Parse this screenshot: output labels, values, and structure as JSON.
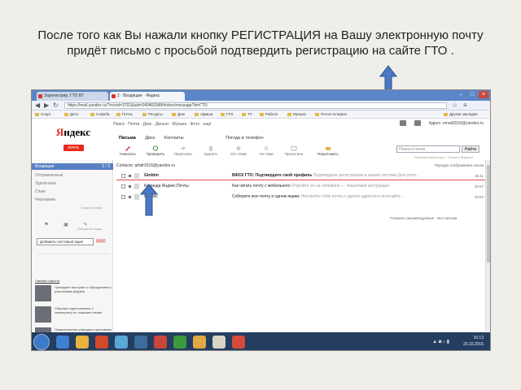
{
  "caption": "После того как Вы нажали кнопку РЕГИСТРАЦИЯ на Вашу электронную почту придёт письмо с просьбой  подтвердить регистрацию на сайте ГТО .",
  "browser": {
    "tabs": [
      "Зарегистрир. ГТО ВТ",
      "2 · Входящие · Яндекс"
    ],
    "url": "https://mail.yandex.ru/?ncrnd=3701&uid=340469348#inbox/message?id=ГТО",
    "bookmarks": [
      "Спорт",
      "Дети",
      "Служба",
      "Почта",
      "Ресурсы",
      "Дом",
      "Афиша",
      "ГТО",
      "TV",
      "Работа",
      "Музыка",
      "Почта телефон"
    ],
    "bookmark_right": "Другие закладки"
  },
  "page": {
    "top_menu": "Поиск · Почта · Диск · Деньги · Музыка · Фото · ещё",
    "user_email": "Адрес: email2016@yandex.ru",
    "logo_text": "Яндекс",
    "logo_badge": "почта",
    "tabs": [
      "Письма",
      "Диск",
      "Контакты",
      "Погода в телефон"
    ],
    "toolbar": [
      "Написать",
      "Проверить",
      "Переслать",
      "Удалить",
      "Это спам!",
      "Не спам",
      "Прочитано",
      "Переложить"
    ],
    "search_placeholder": "Поиск в почте",
    "search_button": "Найти",
    "search_sub": "Расширенный поиск · Поиск в Яндексе",
    "list_header": "Contacts: arbitr2016@yandex.ru",
    "list_header_right": "Порядок отображения писем",
    "emails": [
      {
        "from": "Gtobtm",
        "subject": "ВФСК ГТО: Подтвердите свой профиль",
        "preview": "Подтвердите регистрацию в нашей системе Для этого...",
        "time": "16:11"
      },
      {
        "from": "Команда Яндекс.Почты",
        "subject": "Как читать почту с мобильного",
        "preview": "Откройте ее на телефоне — пошаговая инструкция",
        "time": "16:07"
      },
      {
        "from": "Яндекс",
        "subject": "Соберите всю почту в одном ящике",
        "preview": "Настройте сбор почты с других адресов и получайте...",
        "time": "16:02"
      }
    ],
    "footnote": "Показать рекомендуемые · Все письма",
    "sidebar": {
      "folder_head": "Входящие",
      "folder_count": "3 / 3",
      "folders": [
        "Отправленные",
        "Удалённые",
        "Спам",
        "Черновики"
      ],
      "create_folder": "Создать папку",
      "settings_link": "Настроить ящик",
      "add_mailbox": "Добавить почтовый ящик",
      "news_head": "Свежие новости",
      "news": [
        "Президент выступил с обращением к участникам форума",
        "Сборная подготовилась к чемпионату по лыжным гонкам",
        "Правительство утвердило программу развития"
      ]
    }
  },
  "taskbar": {
    "time": "16:13",
    "date": "23.10.2015"
  },
  "colors": {
    "tabbar": "#5b86c8",
    "sidebar_active": "#587fc4",
    "brand_red": "#e52a1f",
    "arrow_fill": "#4a78c4",
    "taskbar": "#253d61"
  },
  "icons": [
    "arrow-up-icon",
    "arrow-down-icon",
    "back-icon",
    "forward-icon",
    "reload-icon",
    "star-icon",
    "wrench-icon",
    "windows-start-icon"
  ]
}
